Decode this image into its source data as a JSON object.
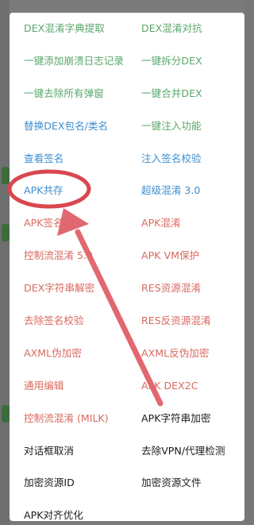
{
  "dialog": {
    "rows": [
      {
        "left": {
          "label": "DEX混淆字典提取",
          "color": "green"
        },
        "right": {
          "label": "DEX混淆对抗",
          "color": "green"
        }
      },
      {
        "left": {
          "label": "一键添加崩溃日志记录",
          "color": "green"
        },
        "right": {
          "label": "一键拆分DEX",
          "color": "green"
        }
      },
      {
        "left": {
          "label": "一键去除所有弹窗",
          "color": "green"
        },
        "right": {
          "label": "一键合并DEX",
          "color": "green"
        }
      },
      {
        "left": {
          "label": "替换DEX包名/类名",
          "color": "blue"
        },
        "right": {
          "label": "一键注入功能",
          "color": "green"
        }
      },
      {
        "left": {
          "label": "查看签名",
          "color": "blue"
        },
        "right": {
          "label": "注入签名校验",
          "color": "blue"
        }
      },
      {
        "left": {
          "label": "APK共存",
          "color": "blue"
        },
        "right": {
          "label": "超级混淆 3.0",
          "color": "blue"
        }
      },
      {
        "left": {
          "label": "APK签名",
          "color": "red"
        },
        "right": {
          "label": "APK混淆",
          "color": "red"
        }
      },
      {
        "left": {
          "label": "控制流混淆 5.0",
          "color": "red"
        },
        "right": {
          "label": "APK VM保护",
          "color": "red"
        }
      },
      {
        "left": {
          "label": "DEX字符串解密",
          "color": "red"
        },
        "right": {
          "label": "RES资源混淆",
          "color": "red"
        }
      },
      {
        "left": {
          "label": "去除签名校验",
          "color": "red"
        },
        "right": {
          "label": "RES反资源混淆",
          "color": "red"
        }
      },
      {
        "left": {
          "label": "AXML伪加密",
          "color": "red"
        },
        "right": {
          "label": "AXML反伪加密",
          "color": "red"
        }
      },
      {
        "left": {
          "label": "通用编辑",
          "color": "red"
        },
        "right": {
          "label": "APK DEX2C",
          "color": "red"
        }
      },
      {
        "left": {
          "label": "控制流混淆 (MILK)",
          "color": "red"
        },
        "right": {
          "label": "APK字符串加密",
          "color": "black"
        }
      },
      {
        "left": {
          "label": "对话框取消",
          "color": "black"
        },
        "right": {
          "label": "去除VPN/代理检测",
          "color": "black"
        }
      },
      {
        "left": {
          "label": "加密资源ID",
          "color": "black"
        },
        "right": {
          "label": "加密资源文件",
          "color": "black"
        }
      },
      {
        "left": {
          "label": "APK对齐优化",
          "color": "black"
        },
        "right": {
          "label": "",
          "color": "black"
        }
      }
    ]
  },
  "annotation": {
    "stroke_color": "#d9474f",
    "fill_color": "#e16870",
    "highlighted_item": "APK共存"
  }
}
